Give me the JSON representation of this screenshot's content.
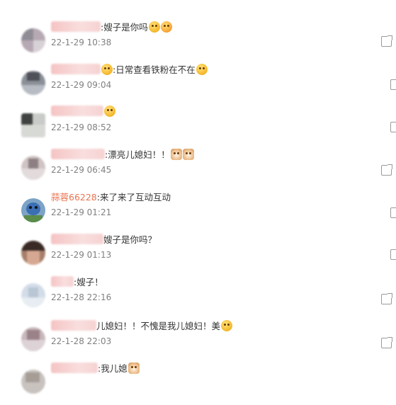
{
  "comments": [
    {
      "text": ":嫂子是你吗",
      "time": "22-1-29 10:38",
      "emojis": [
        "cry-laugh-emoji",
        "surprised-emoji"
      ]
    },
    {
      "text": ":日常查看铁粉在不在",
      "time": "22-1-29 09:04",
      "emojis": [
        "kiss-emoji"
      ]
    },
    {
      "text": "",
      "time": "22-1-29 08:52",
      "emojis": [
        "crying-emoji"
      ]
    },
    {
      "text": ":漂亮儿媳妇！！",
      "time": "22-1-29 06:45",
      "emojis": [
        "cat-emoji",
        "cat-emoji"
      ]
    },
    {
      "username": "蒜蓉66228",
      "text": ":来了来了互动互动",
      "time": "22-1-29 01:21",
      "emojis": []
    },
    {
      "text": "嫂子是你吗？",
      "time": "22-1-29 01:13",
      "emojis": []
    },
    {
      "text": ":嫂子！",
      "time": "22-1-28 22:16",
      "emojis": []
    },
    {
      "text": "儿媳妇！！不愧是我儿媳妇！美",
      "time": "22-1-28 22:03",
      "emojis": [
        "shy-emoji"
      ]
    },
    {
      "text": ":我儿媳",
      "time": "",
      "emojis": [
        "cat-emoji"
      ]
    }
  ],
  "icons": {
    "reply": "reply-icon"
  }
}
